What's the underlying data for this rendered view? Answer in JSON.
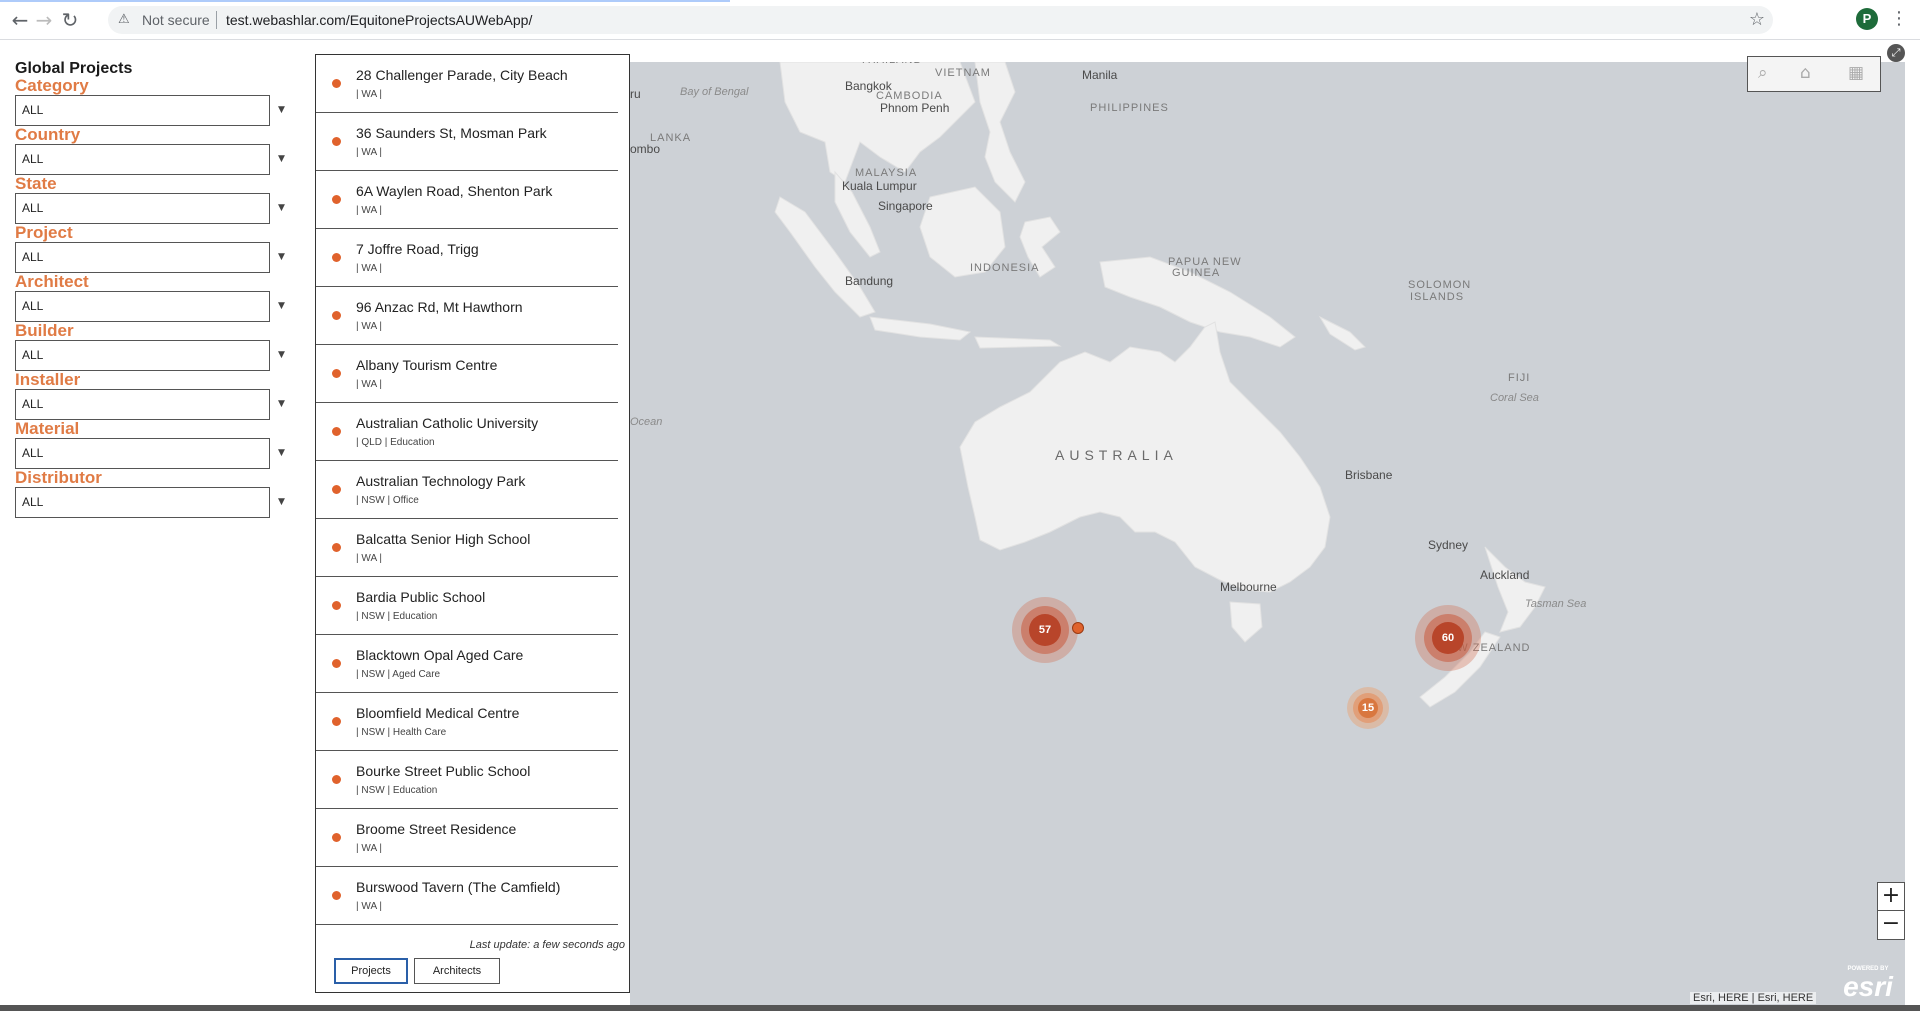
{
  "browser": {
    "security_label": "Not secure",
    "url": "test.webashlar.com/EquitoneProjectsAUWebApp/",
    "profile_initial": "P"
  },
  "filters": {
    "title": "Global Projects",
    "items": [
      {
        "label": "Category",
        "value": "ALL"
      },
      {
        "label": "Country",
        "value": "ALL"
      },
      {
        "label": "State",
        "value": "ALL"
      },
      {
        "label": "Project",
        "value": "ALL"
      },
      {
        "label": "Architect",
        "value": "ALL"
      },
      {
        "label": "Builder",
        "value": "ALL"
      },
      {
        "label": "Installer",
        "value": "ALL"
      },
      {
        "label": "Material",
        "value": "ALL"
      },
      {
        "label": "Distributor",
        "value": "ALL"
      }
    ]
  },
  "projects": {
    "items": [
      {
        "name": "28 Challenger Parade, City Beach",
        "meta": "| WA |"
      },
      {
        "name": "36 Saunders St, Mosman Park",
        "meta": "| WA |"
      },
      {
        "name": "6A Waylen Road, Shenton Park",
        "meta": "| WA |"
      },
      {
        "name": "7 Joffre Road, Trigg",
        "meta": "| WA |"
      },
      {
        "name": "96 Anzac Rd, Mt Hawthorn",
        "meta": "| WA |"
      },
      {
        "name": "Albany Tourism Centre",
        "meta": "| WA |"
      },
      {
        "name": "Australian Catholic University",
        "meta": "| QLD | Education"
      },
      {
        "name": "Australian Technology Park",
        "meta": "| NSW | Office"
      },
      {
        "name": "Balcatta Senior High School",
        "meta": "| WA |"
      },
      {
        "name": "Bardia Public School",
        "meta": "| NSW | Education"
      },
      {
        "name": "Blacktown Opal Aged Care",
        "meta": "| NSW | Aged Care"
      },
      {
        "name": "Bloomfield Medical Centre",
        "meta": "| NSW | Health Care"
      },
      {
        "name": "Bourke Street Public School",
        "meta": "| NSW | Education"
      },
      {
        "name": "Broome Street Residence",
        "meta": "| WA |"
      },
      {
        "name": "Burswood Tavern (The Camfield)",
        "meta": "| WA |"
      }
    ],
    "last_update": "Last update: a few seconds ago",
    "tab_projects": "Projects",
    "tab_architects": "Architects",
    "collapse_symbol": "«"
  },
  "map": {
    "labels": [
      {
        "text": "THAILAND",
        "kind": "country"
      },
      {
        "text": "VIETNAM",
        "kind": "country"
      },
      {
        "text": "Manila",
        "kind": "city"
      },
      {
        "text": "Bangkok",
        "kind": "city"
      },
      {
        "text": "CAMBODIA",
        "kind": "country"
      },
      {
        "text": "Phnom Penh",
        "kind": "city"
      },
      {
        "text": "PHILIPPINES",
        "kind": "country"
      },
      {
        "text": "Bay of Bengal",
        "kind": "sea"
      },
      {
        "text": "ru",
        "kind": "city"
      },
      {
        "text": "LANKA",
        "kind": "country"
      },
      {
        "text": "ombo",
        "kind": "city"
      },
      {
        "text": "MALAYSIA",
        "kind": "country"
      },
      {
        "text": "Kuala Lumpur",
        "kind": "city"
      },
      {
        "text": "Singapore",
        "kind": "city"
      },
      {
        "text": "Bandung",
        "kind": "city"
      },
      {
        "text": "INDONESIA",
        "kind": "country"
      },
      {
        "text": "PAPUA NEW",
        "kind": "country"
      },
      {
        "text": "GUINEA",
        "kind": "country"
      },
      {
        "text": "SOLOMON",
        "kind": "country"
      },
      {
        "text": "ISLANDS",
        "kind": "country"
      },
      {
        "text": "FIJI",
        "kind": "country"
      },
      {
        "text": "Coral Sea",
        "kind": "sea"
      },
      {
        "text": "Ocean",
        "kind": "sea"
      },
      {
        "text": "AUSTRALIA",
        "kind": "big"
      },
      {
        "text": "Brisbane",
        "kind": "city"
      },
      {
        "text": "Sydney",
        "kind": "city"
      },
      {
        "text": "Melbourne",
        "kind": "city"
      },
      {
        "text": "Auckland",
        "kind": "city"
      },
      {
        "text": "Tasman Sea",
        "kind": "sea"
      },
      {
        "text": "NEW ZEALAND",
        "kind": "country"
      }
    ],
    "clusters": [
      {
        "count": "57"
      },
      {
        "count": "60"
      },
      {
        "count": "15"
      }
    ],
    "attribution": "Esri, HERE | Esri, HERE",
    "esri_powered": "POWERED BY",
    "esri_logo": "esri",
    "zoom_in": "+",
    "zoom_out": "−",
    "colors": {
      "water": "#cdd1d6",
      "land": "#f0f0f0",
      "accent": "#e07b45",
      "marker": "#e0622c"
    }
  }
}
